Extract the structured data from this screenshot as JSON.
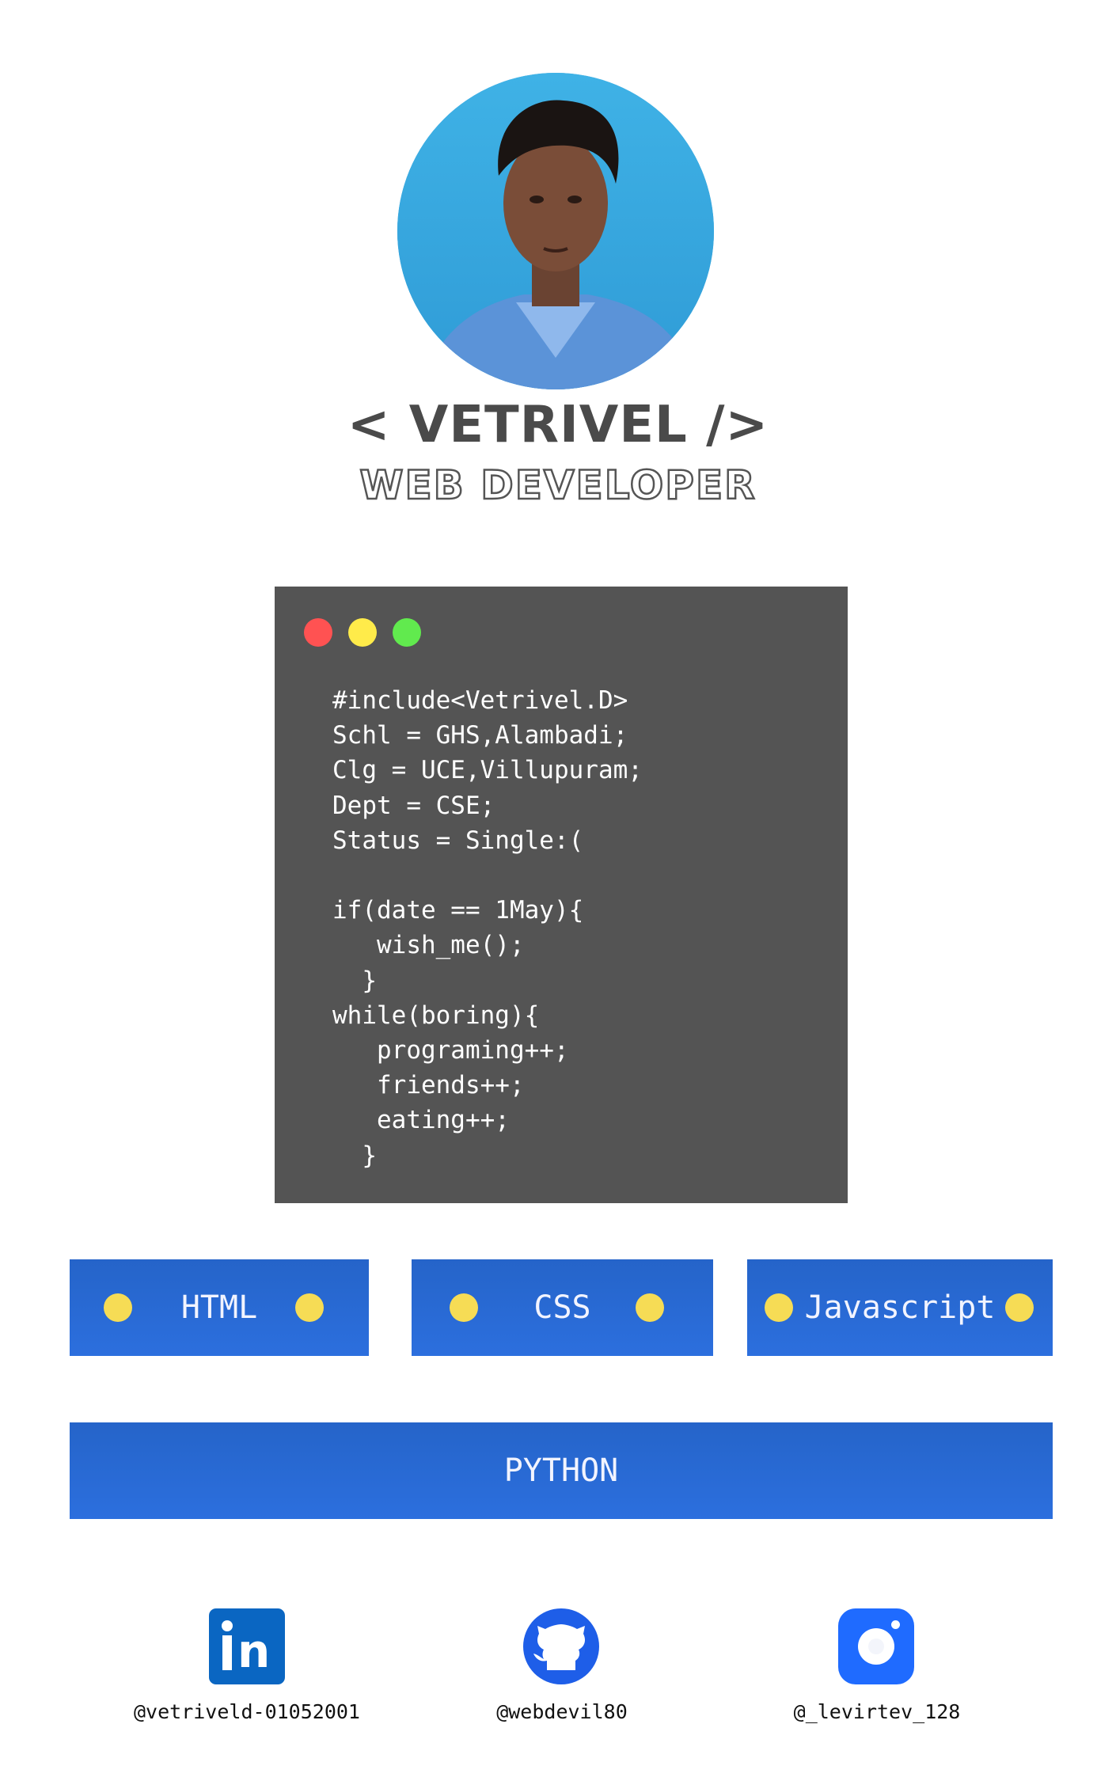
{
  "profile": {
    "name": "< VETRIVEL />",
    "role": "WEB DEVELOPER"
  },
  "code_window": {
    "lines": [
      "#include<Vetrivel.D>",
      "Schl = GHS,Alambadi;",
      "Clg = UCE,Villupuram;",
      "Dept = CSE;",
      "Status = Single:(",
      "",
      "if(date == 1May){",
      "   wish_me();",
      "  }",
      "while(boring){",
      "   programing++;",
      "   friends++;",
      "   eating++;",
      "  }"
    ],
    "controls": {
      "close": "#ff5252",
      "minimize": "#ffeb4a",
      "maximize": "#61ea4e"
    }
  },
  "skills": [
    "HTML",
    "CSS",
    "Javascript",
    "PYTHON"
  ],
  "social": {
    "linkedin": {
      "icon": "linkedin-icon",
      "handle": "@vetriveld-01052001"
    },
    "github": {
      "icon": "github-icon",
      "handle": "@webdevil80"
    },
    "instagram": {
      "icon": "camera-icon",
      "handle": "@_levirtev_128"
    }
  },
  "colors": {
    "skill_bg": "#2a6ad6",
    "bullet": "#f6dc55",
    "code_bg": "#545454",
    "heading": "#4a4a4a"
  }
}
